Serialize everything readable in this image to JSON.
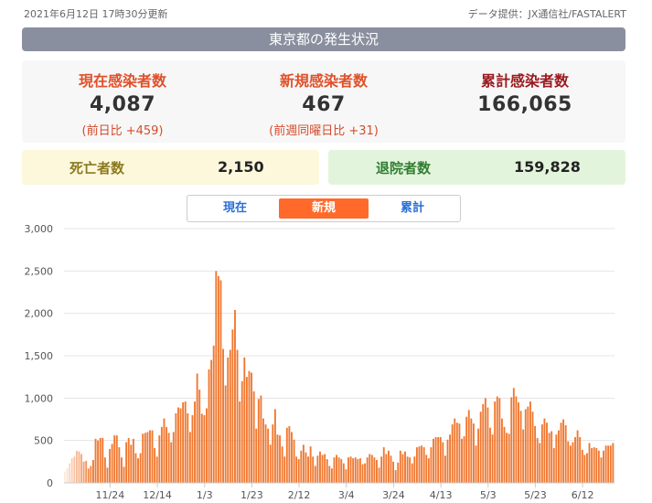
{
  "header": {
    "updated": "2021年6月12日 17時30分更新",
    "source": "データ提供：JX通信社/FASTALERT",
    "title": "東京都の発生状況"
  },
  "stats": [
    {
      "label": "現在感染者数",
      "value": "4,087",
      "sub": "(前日比 +459)"
    },
    {
      "label": "新規感染者数",
      "value": "467",
      "sub": "(前週同曜日比 +31)"
    },
    {
      "label": "累計感染者数",
      "value": "166,065",
      "sub": ""
    }
  ],
  "deaths": {
    "label": "死亡者数",
    "value": "2,150"
  },
  "recovered": {
    "label": "退院者数",
    "value": "159,828"
  },
  "tabs": [
    {
      "label": "現在",
      "active": false
    },
    {
      "label": "新規",
      "active": true
    },
    {
      "label": "累計",
      "active": false
    }
  ],
  "colors": {
    "bar": "#f07830",
    "active_tab": "#ff6a2b",
    "title_bar": "#8a8f9f"
  },
  "chart_data": {
    "type": "bar",
    "ylim": [
      0,
      3000
    ],
    "yticks": [
      0,
      500,
      1000,
      1500,
      2000,
      2500,
      3000
    ],
    "ytick_labels": [
      "0",
      "500",
      "1,000",
      "1,500",
      "2,000",
      "2,500",
      "3,000"
    ],
    "xtick_labels": [
      "11/24",
      "12/14",
      "1/3",
      "1/23",
      "2/12",
      "3/4",
      "3/24",
      "4/13",
      "5/3",
      "5/23",
      "6/12"
    ],
    "xtick_indices": [
      19,
      39,
      59,
      79,
      99,
      119,
      139,
      159,
      179,
      199,
      219
    ],
    "values": [
      130,
      170,
      230,
      290,
      310,
      380,
      370,
      340,
      250,
      260,
      170,
      200,
      270,
      520,
      500,
      530,
      530,
      300,
      180,
      400,
      460,
      560,
      560,
      420,
      300,
      190,
      480,
      530,
      450,
      520,
      350,
      290,
      350,
      580,
      590,
      600,
      620,
      620,
      410,
      310,
      560,
      660,
      760,
      660,
      590,
      480,
      600,
      820,
      890,
      880,
      950,
      960,
      820,
      600,
      800,
      960,
      1290,
      1100,
      816,
      800,
      880,
      1340,
      1450,
      1620,
      2500,
      2440,
      2390,
      1580,
      1150,
      1480,
      1570,
      1810,
      2040,
      1570,
      960,
      1200,
      1480,
      1250,
      1320,
      1300,
      1080,
      640,
      990,
      1030,
      760,
      690,
      640,
      450,
      690,
      870,
      570,
      560,
      430,
      310,
      650,
      670,
      600,
      510,
      310,
      280,
      380,
      450,
      360,
      310,
      430,
      310,
      200,
      320,
      370,
      330,
      340,
      280,
      200,
      170,
      300,
      330,
      300,
      280,
      230,
      160,
      300,
      310,
      290,
      300,
      280,
      290,
      220,
      230,
      300,
      340,
      330,
      300,
      270,
      180,
      310,
      420,
      340,
      380,
      320,
      250,
      150,
      240,
      380,
      340,
      370,
      310,
      300,
      230,
      310,
      420,
      430,
      440,
      420,
      330,
      290,
      420,
      520,
      540,
      540,
      540,
      480,
      320,
      510,
      570,
      690,
      760,
      710,
      700,
      520,
      550,
      780,
      860,
      760,
      700,
      440,
      640,
      840,
      930,
      1000,
      890,
      650,
      570,
      960,
      1020,
      1000,
      760,
      660,
      590,
      580,
      1010,
      1120,
      1020,
      950,
      850,
      630,
      870,
      900,
      960,
      840,
      670,
      530,
      470,
      690,
      760,
      710,
      590,
      610,
      410,
      570,
      620,
      710,
      750,
      680,
      490,
      440,
      480,
      540,
      620,
      540,
      390,
      330,
      350,
      470,
      410,
      420,
      410,
      380,
      300,
      380,
      440,
      440,
      440,
      470
    ]
  }
}
